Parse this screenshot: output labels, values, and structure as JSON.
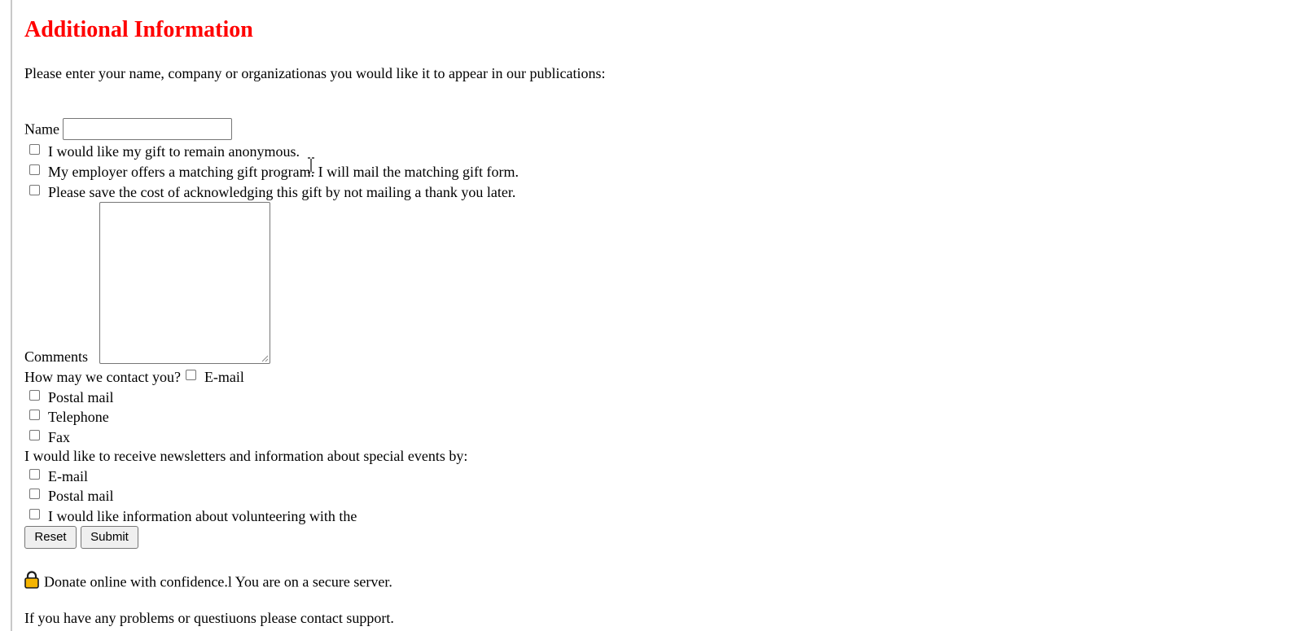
{
  "section": {
    "title": "Additional Information",
    "intro": "Please enter your name, company or organizationas you would like it to appear in our publications:"
  },
  "name_field": {
    "label": "Name",
    "value": ""
  },
  "gift_options": [
    "I would like my gift to remain anonymous.",
    "My employer offers a matching gift program. I will mail the matching gift form.",
    "Please save the cost of acknowledging this gift by not mailing a thank you later."
  ],
  "comments": {
    "label": "Comments",
    "value": ""
  },
  "contact": {
    "question": "How may we contact you?",
    "options": [
      "E-mail",
      "Postal mail",
      "Telephone",
      "Fax"
    ]
  },
  "newsletter": {
    "question": "I would like to receive newsletters and information about special events by:",
    "options": [
      "E-mail",
      "Postal mail",
      "I would like information about volunteering with the"
    ]
  },
  "buttons": {
    "reset": "Reset",
    "submit": "Submit"
  },
  "security": {
    "message": "Donate online with confidence.l You are on a secure server."
  },
  "support": {
    "message": "If you have any problems or questiuons please contact support."
  },
  "colors": {
    "title": "#ff0000",
    "lock": "#f5b400"
  }
}
